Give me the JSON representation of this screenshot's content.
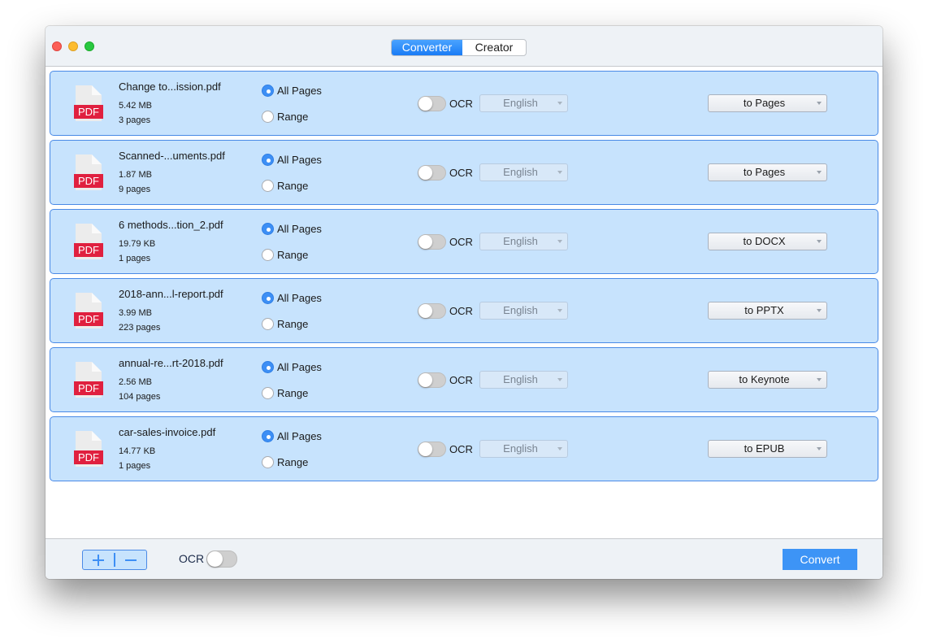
{
  "window": {
    "tabs": [
      {
        "label": "Converter",
        "active": true
      },
      {
        "label": "Creator",
        "active": false
      }
    ]
  },
  "files": [
    {
      "name": "Change to...ission.pdf",
      "size": "5.42 MB",
      "pages": "3 pages",
      "page_mode": "All Pages",
      "ocr_enabled": false,
      "language": "English",
      "format": "to Pages"
    },
    {
      "name": "Scanned-...uments.pdf",
      "size": "1.87 MB",
      "pages": "9 pages",
      "page_mode": "All Pages",
      "ocr_enabled": false,
      "language": "English",
      "format": "to Pages"
    },
    {
      "name": "6 methods...tion_2.pdf",
      "size": "19.79 KB",
      "pages": "1 pages",
      "page_mode": "All Pages",
      "ocr_enabled": false,
      "language": "English",
      "format": "to DOCX"
    },
    {
      "name": "2018-ann...l-report.pdf",
      "size": "3.99 MB",
      "pages": "223 pages",
      "page_mode": "All Pages",
      "ocr_enabled": false,
      "language": "English",
      "format": "to PPTX"
    },
    {
      "name": "annual-re...rt-2018.pdf",
      "size": "2.56 MB",
      "pages": "104 pages",
      "page_mode": "All Pages",
      "ocr_enabled": false,
      "language": "English",
      "format": "to Keynote"
    },
    {
      "name": "car-sales-invoice.pdf",
      "size": "14.77 KB",
      "pages": "1 pages",
      "page_mode": "All Pages",
      "ocr_enabled": false,
      "language": "English",
      "format": "to EPUB"
    }
  ],
  "row_labels": {
    "pdf_badge": "PDF",
    "all_pages": "All Pages",
    "range": "Range",
    "ocr": "OCR"
  },
  "footer": {
    "add_symbol": "+",
    "remove_symbol": "−",
    "ocr_label": "OCR",
    "ocr_enabled": false,
    "convert_label": "Convert"
  },
  "colors": {
    "accent": "#3d8ff5",
    "row_bg": "#c7e3fd",
    "row_border": "#4a8ae6",
    "pdf_red": "#e0203f"
  }
}
